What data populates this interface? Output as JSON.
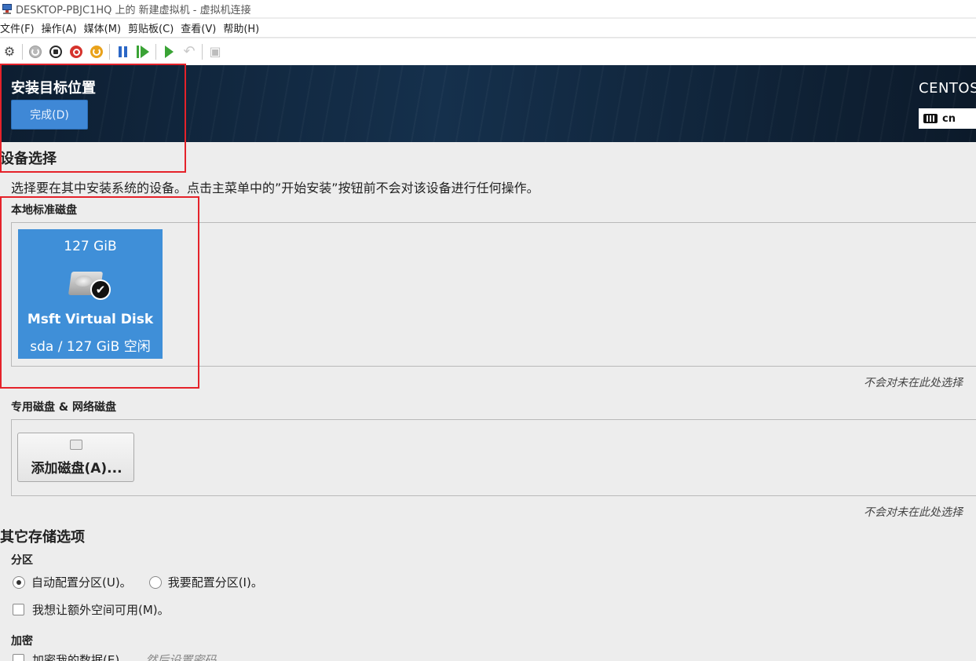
{
  "window": {
    "title": "DESKTOP-PBJC1HQ 上的 新建虚拟机 - 虚拟机连接"
  },
  "menu": {
    "items": [
      "文件(F)",
      "操作(A)",
      "媒体(M)",
      "剪贴板(C)",
      "查看(V)",
      "帮助(H)"
    ]
  },
  "toolbar": {
    "icons": [
      "ctrl-alt-del-icon",
      "start-icon",
      "turn-off-icon",
      "shutdown-icon",
      "save-icon",
      "pause-icon",
      "resume-icon",
      "checkpoint-icon",
      "revert-icon",
      "enhanced-session-icon"
    ]
  },
  "header": {
    "title": "安装目标位置",
    "done_label": "完成(D)",
    "brand": "CENTOS",
    "keyboard_layout": "cn"
  },
  "device_selection": {
    "heading": "设备选择",
    "description": "选择要在其中安装系统的设备。点击主菜单中的”开始安装”按钮前不会对该设备进行任何操作。",
    "local_disks_heading": "本地标准磁盘",
    "disk": {
      "size": "127 GiB",
      "name": "Msft Virtual Disk",
      "detail": "sda  /  127 GiB 空闲",
      "selected": true
    },
    "local_note": "不会对未在此处选择",
    "specialized_heading": "专用磁盘 & 网络磁盘",
    "add_disk_label": "添加磁盘(A)...",
    "specialized_note": "不会对未在此处选择"
  },
  "other_storage": {
    "heading": "其它存储选项",
    "partition_heading": "分区",
    "auto_partition_label": "自动配置分区(U)。",
    "manual_partition_label": "我要配置分区(I)。",
    "auto_selected": true,
    "extra_space_label": "我想让额外空间可用(M)。",
    "encryption_heading": "加密",
    "encrypt_label": "加密我的数据(E)。",
    "encrypt_hint": "然后设置密码"
  },
  "colors": {
    "header_bg": "#102338",
    "accent": "#3f88d6",
    "disk_tile": "#3f8fd8",
    "highlight": "#e5222a"
  }
}
